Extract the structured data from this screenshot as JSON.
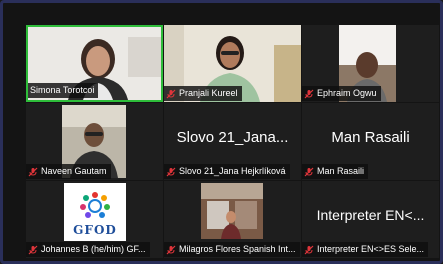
{
  "participants": [
    {
      "name": "Simona Torotcoi",
      "muted": false,
      "active": true
    },
    {
      "name": "Pranjali Kureel",
      "muted": true
    },
    {
      "name": "Ephraim Ogwu",
      "muted": true
    },
    {
      "name": "Naveen Gautam",
      "muted": true
    },
    {
      "name": "Slovo 21_Jana Hejkrlíková",
      "display_text": "Slovo 21_Jana...",
      "muted": true
    },
    {
      "name": "Man Rasaili",
      "display_text": "Man Rasaili",
      "muted": true
    },
    {
      "name": "Johannes B (he/him) GF...",
      "muted": true,
      "logo_text": "GFOD"
    },
    {
      "name": "Milagros Flores Spanish Int...",
      "muted": true
    },
    {
      "name": "Interpreter EN<>ES Sele...",
      "display_text": "Interpreter EN<...",
      "muted": true
    }
  ],
  "colors": {
    "active_border": "#2ebd3a",
    "muted_icon": "#e0353b",
    "frame": "#2a2f5a"
  }
}
